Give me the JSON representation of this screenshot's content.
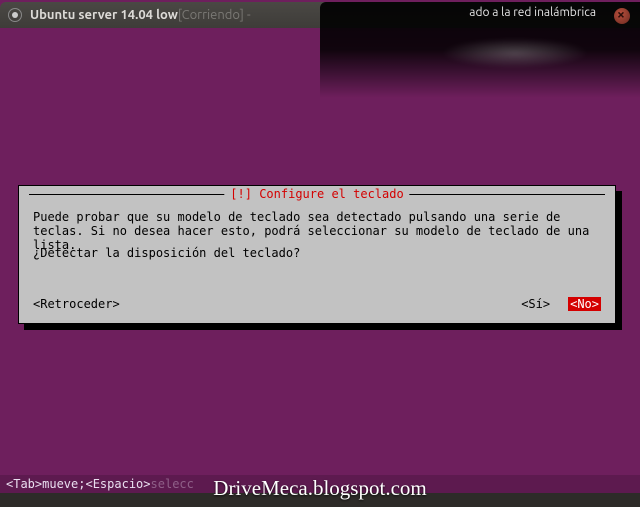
{
  "window": {
    "title_main": "Ubuntu server 14.04 low",
    "title_state": " [Corriendo] - ",
    "fragment_text": "ado a la red inalámbrica"
  },
  "dialog": {
    "title": "[!] Configure el teclado",
    "body_text": "Puede probar que su modelo de teclado sea detectado pulsando una serie de teclas. Si no desea hacer esto, podrá seleccionar su modelo de teclado de una lista.",
    "question": "¿Detectar la disposición del teclado?",
    "back_label": "<Retroceder>",
    "yes_label": "<Sí>",
    "no_label": "<No>"
  },
  "statusbar": {
    "tab_key": "<Tab>",
    "tab_action": " mueve; ",
    "space_key": "<Espacio>",
    "space_action": " selecc"
  },
  "watermark": "DriveMeca.blogspot.com"
}
